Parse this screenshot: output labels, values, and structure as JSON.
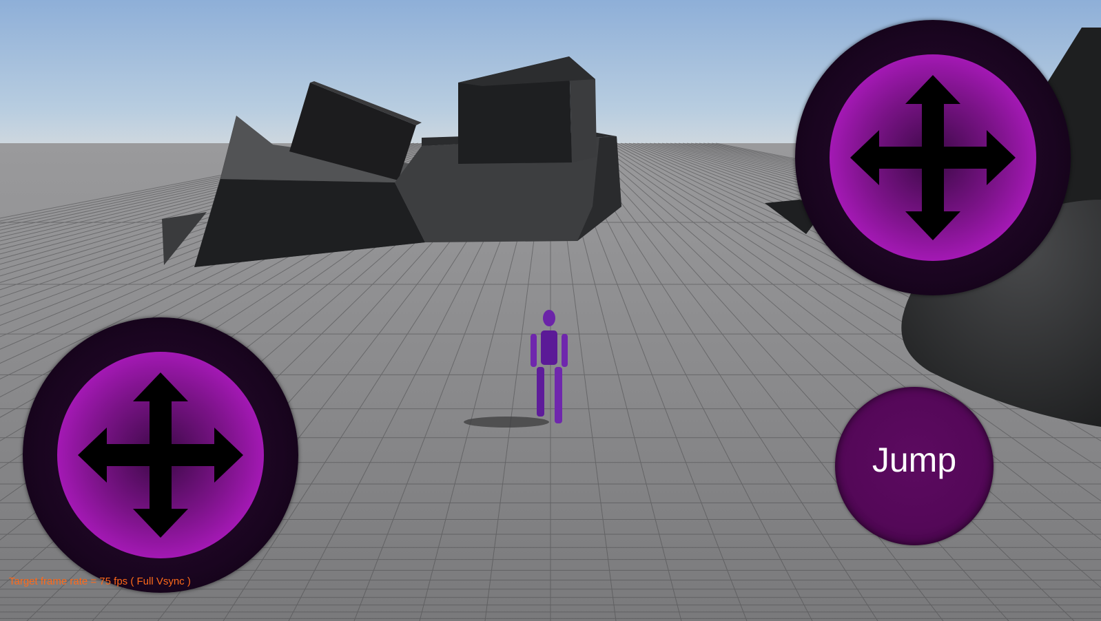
{
  "hud": {
    "jump_label": "Jump",
    "fps_text": "Target frame rate = 75 fps ( Full Vsync )"
  },
  "controls": {
    "left_joystick_icon": "move-arrows-icon",
    "right_joystick_icon": "move-arrows-icon"
  },
  "colors": {
    "joystick_ring": "#1a0520",
    "joystick_fill": "#b21bc4",
    "jump_fill": "#540858",
    "fps_text": "#ff6a1a",
    "character": "#6a1fa8"
  }
}
